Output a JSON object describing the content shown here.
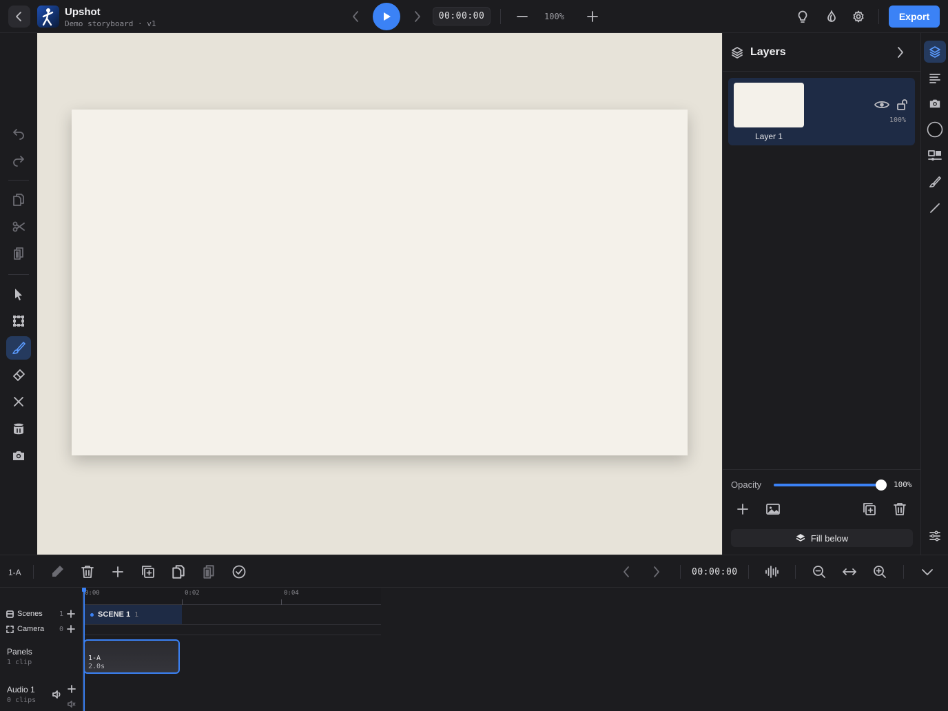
{
  "header": {
    "app_name": "Upshot",
    "subtitle": "Demo storyboard · v1",
    "timecode": "00:00:00",
    "zoom": "100%",
    "export_label": "Export"
  },
  "left_tools": [
    "undo-icon",
    "redo-icon",
    "copy-icon",
    "scissors-icon",
    "paste-icon",
    "pointer-icon",
    "transform-icon",
    "brush-icon",
    "eraser-icon",
    "clear-icon",
    "bucket-icon",
    "camera-icon"
  ],
  "active_tool": "brush",
  "layers": {
    "title": "Layers",
    "items": [
      {
        "name": "Layer 1",
        "opacity": "100%",
        "visible": true,
        "locked": false
      }
    ],
    "opacity_label": "Opacity",
    "opacity_value": "100%",
    "opacity_fraction": 1.0,
    "fill_below_label": "Fill below"
  },
  "bottom_toolbar": {
    "panel_id": "1-A",
    "timecode": "00:00:00"
  },
  "timeline": {
    "ruler": [
      "0:00",
      "0:02",
      "0:04"
    ],
    "tracks": {
      "scenes": {
        "label": "Scenes",
        "count": "1"
      },
      "camera": {
        "label": "Camera",
        "count": "0"
      },
      "panels": {
        "label": "Panels",
        "sub": "1 clip"
      },
      "audio": {
        "label": "Audio 1",
        "sub": "0 clips"
      }
    },
    "scene": {
      "name": "SCENE 1",
      "count": "1"
    },
    "clip": {
      "name": "1-A",
      "duration": "2.0s"
    }
  },
  "colors": {
    "accent": "#3b82f6",
    "background": "#1c1c1f",
    "canvas": "#f4f1ea",
    "canvas_bg": "#e7e3d9",
    "selected": "#1e2b45"
  }
}
